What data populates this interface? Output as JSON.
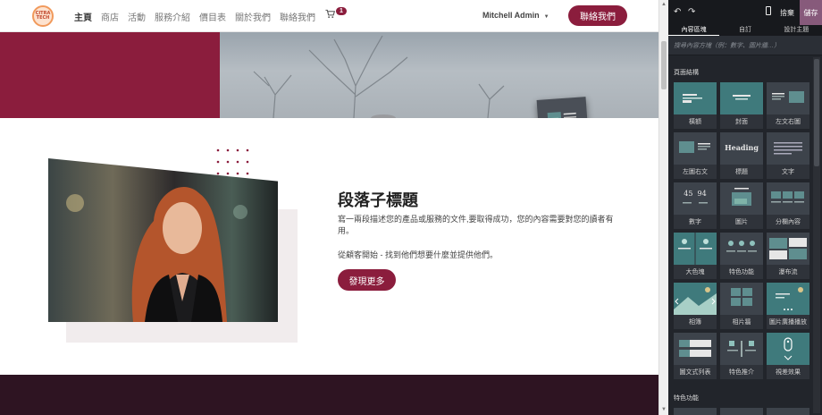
{
  "navbar": {
    "logo_text": "CITRA TECH",
    "menu": [
      "主頁",
      "商店",
      "活動",
      "服務介紹",
      "價目表",
      "關於我們",
      "聯絡我們"
    ],
    "cart_count": "1",
    "user_name": "Mitchell Admin",
    "cta_label": "聯絡我們"
  },
  "content": {
    "subtitle": "段落子標題",
    "paragraph1": "寫一兩段描述您的產品或服務的文件,要取得成功，您的內容需要對您的讀者有用。",
    "paragraph2": "從顧客開始 - 找到他們想要什麼並提供他們。",
    "button_label": "發現更多"
  },
  "editor": {
    "discard_label": "捨棄",
    "save_label": "儲存",
    "tabs": [
      "內容區塊",
      "自訂",
      "設計主題"
    ],
    "search_placeholder": "搜尋內容方塊（例：數字、圖片牆…）",
    "section_structure": "頁面結構",
    "section_features": "特色功能",
    "snippets": [
      "橫額",
      "封面",
      "左文右圖",
      "左圖右文",
      "標題",
      "文字",
      "數字",
      "圖片",
      "分欄內容",
      "大色塊",
      "特色功能",
      "瀑布流",
      "相簿",
      "相片牆",
      "圖片廣播播放",
      "圖文式列表",
      "特色推介",
      "視差效果"
    ],
    "heading_thumb_text": "Heading",
    "numbers_thumb_text": "45  94"
  },
  "colors": {
    "brand": "#8b1d3d",
    "editor_bg": "#22252b",
    "editor_accent": "#875a7b",
    "dark_band": "#2e1422"
  }
}
